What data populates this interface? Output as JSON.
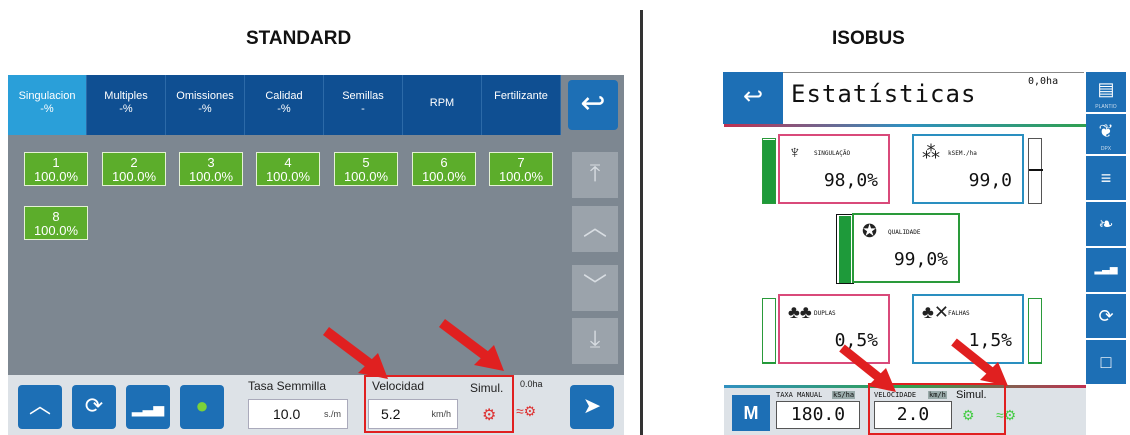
{
  "headings": {
    "left": "STANDARD",
    "right": "ISOBUS"
  },
  "standard": {
    "tabs": [
      {
        "label": "Singulacion\n-%",
        "active": true
      },
      {
        "label": "Multiples\n-%",
        "active": false
      },
      {
        "label": "Omissiones\n-%",
        "active": false
      },
      {
        "label": "Calidad\n-%",
        "active": false
      },
      {
        "label": "Semillas\n-",
        "active": false
      },
      {
        "label": "RPM",
        "active": false
      },
      {
        "label": "Fertilizante",
        "active": false
      }
    ],
    "rows": [
      {
        "num": "1",
        "pct": "100.0%"
      },
      {
        "num": "2",
        "pct": "100.0%"
      },
      {
        "num": "3",
        "pct": "100.0%"
      },
      {
        "num": "4",
        "pct": "100.0%"
      },
      {
        "num": "5",
        "pct": "100.0%"
      },
      {
        "num": "6",
        "pct": "100.0%"
      },
      {
        "num": "7",
        "pct": "100.0%"
      },
      {
        "num": "8",
        "pct": "100.0%"
      }
    ],
    "tasa_label": "Tasa Semmilla",
    "tasa_value": "10.0",
    "tasa_unit": "s./m",
    "velocidad_label": "Velocidad",
    "velocidad_value": "5.2",
    "velocidad_unit": "km/h",
    "simul_label": "Simul.",
    "area": "0.0ha"
  },
  "isobus": {
    "title": "Estatísticas",
    "area": "0,0ha",
    "cards": {
      "singulacao": {
        "label": "SINGULAÇÃO",
        "value": "98,0%"
      },
      "ksem": {
        "label": "kSEM./ha",
        "value": "99,0"
      },
      "qualidade": {
        "label": "QUALIDADE",
        "value": "99,0%"
      },
      "duplas": {
        "label": "DUPLAS",
        "value": "0,5%"
      },
      "falhas": {
        "label": "FALHAS",
        "value": "1,5%"
      }
    },
    "side_labels": {
      "plantio": "PLANTIO",
      "dpx": "DPX"
    },
    "m_label": "M",
    "taxa_label": "TAXA MANUAL",
    "taxa_unit": "kS/ha",
    "taxa_value": "180.0",
    "velocidade_label": "VELOCIDADE",
    "velocidade_unit": "km/h",
    "velocidade_value": "2.0",
    "simul_label": "Simul."
  },
  "colors": {
    "accent_blue": "#1d6fb5",
    "row_green": "#5cad2b",
    "highlight_red": "#e02020"
  }
}
